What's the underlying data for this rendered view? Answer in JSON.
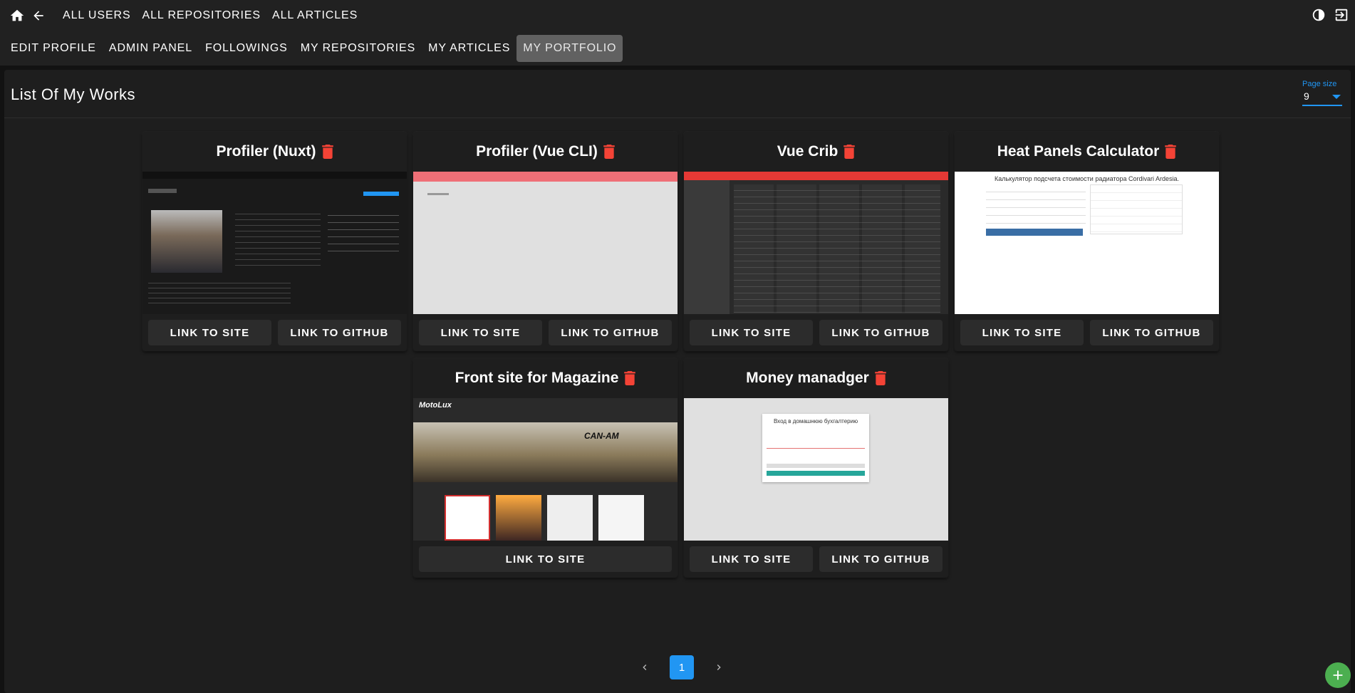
{
  "topbar": {
    "nav": [
      "ALL USERS",
      "ALL REPOSITORIES",
      "ALL ARTICLES"
    ],
    "icons": [
      "home-icon",
      "arrow-back-icon",
      "theme-toggle-icon",
      "logout-icon"
    ]
  },
  "tabs": [
    {
      "label": "EDIT PROFILE",
      "active": false
    },
    {
      "label": "ADMIN PANEL",
      "active": false
    },
    {
      "label": "FOLLOWINGS",
      "active": false
    },
    {
      "label": "MY REPOSITORIES",
      "active": false
    },
    {
      "label": "MY ARTICLES",
      "active": false
    },
    {
      "label": "MY PORTFOLIO",
      "active": true
    }
  ],
  "page": {
    "title": "List Of My Works",
    "page_size_label": "Page size",
    "page_size_value": "9"
  },
  "works": [
    {
      "title": "Profiler (Nuxt)",
      "buttons": [
        "LINK TO SITE",
        "LINK TO GITHUB"
      ]
    },
    {
      "title": "Profiler (Vue CLI)",
      "buttons": [
        "LINK TO SITE",
        "LINK TO GITHUB"
      ]
    },
    {
      "title": "Vue Crib",
      "buttons": [
        "LINK TO SITE",
        "LINK TO GITHUB"
      ]
    },
    {
      "title": "Heat Panels Calculator",
      "buttons": [
        "LINK TO SITE",
        "LINK TO GITHUB"
      ],
      "shot_heading": "Калькулятор подсчета стоимости радиатора Cordivari Ardesia."
    },
    {
      "title": "Front site for Magazine",
      "buttons": [
        "LINK TO SITE"
      ],
      "shot_logo": "MotoLux",
      "shot_brand": "CAN-AM"
    },
    {
      "title": "Money manadger",
      "buttons": [
        "LINK TO SITE",
        "LINK TO GITHUB"
      ],
      "shot_heading": "Вход в домашнюю бухгалтерию"
    }
  ],
  "pagination": {
    "current": "1"
  },
  "colors": {
    "accent": "#2196f3",
    "delete": "#f44336",
    "fab": "#4caf50",
    "active_tab": "#616161"
  }
}
